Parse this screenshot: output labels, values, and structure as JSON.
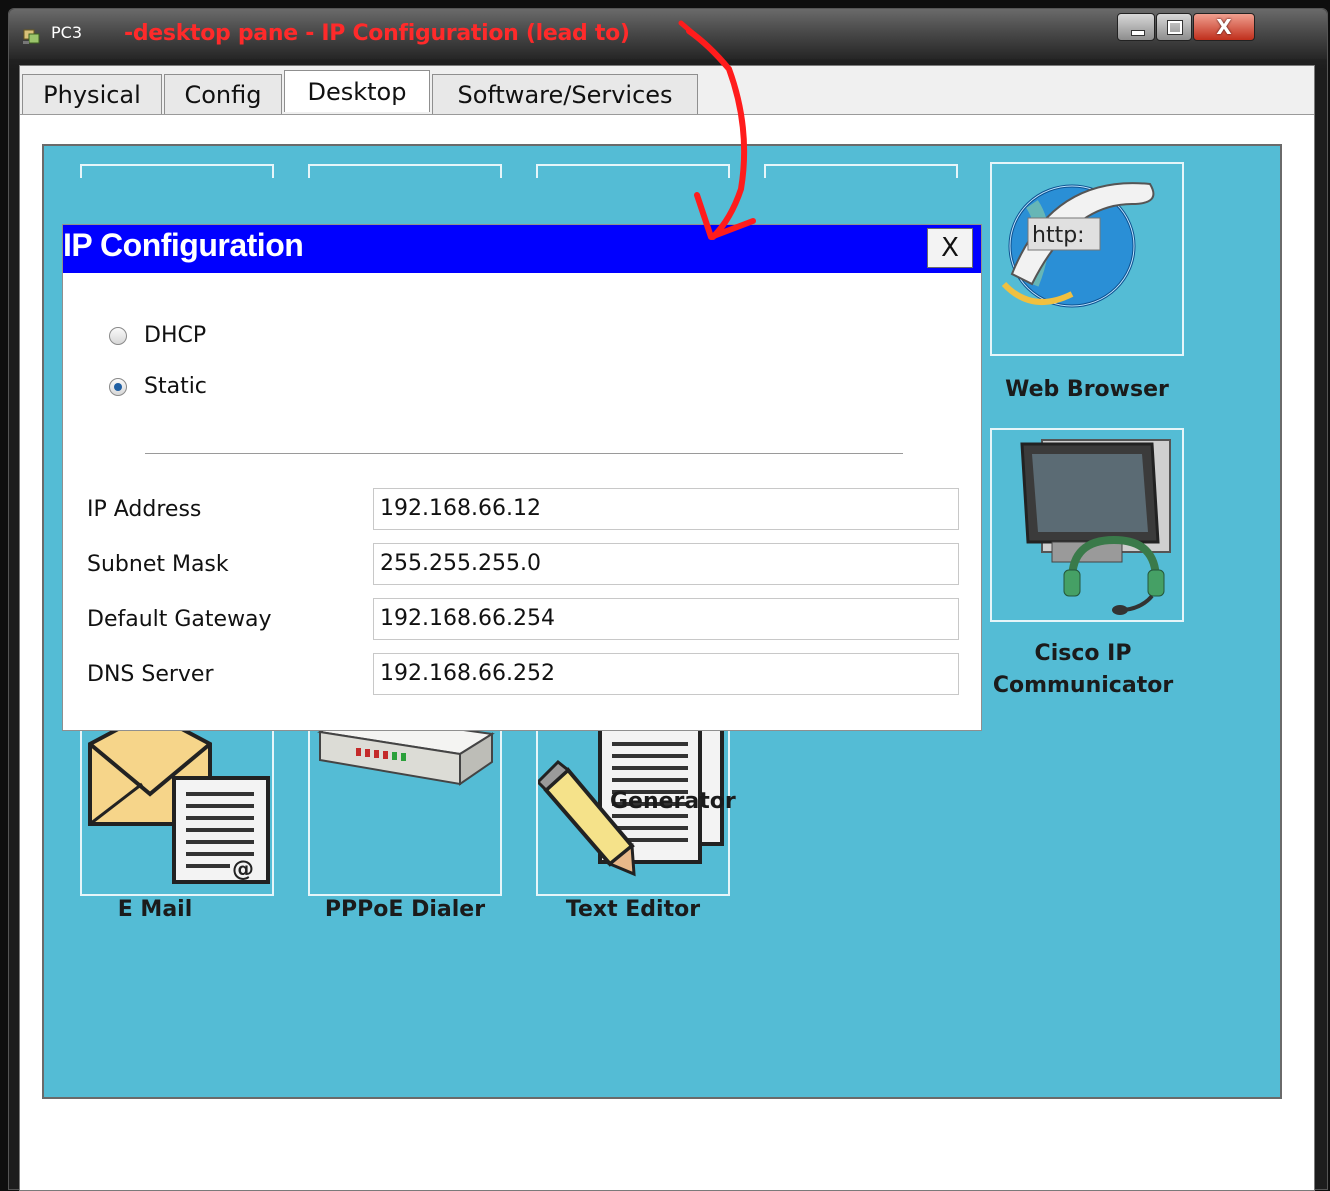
{
  "window": {
    "title": "PC3",
    "annotation": "-desktop pane - IP Configuration (lead to)",
    "close_glyph": "X"
  },
  "tabs": [
    {
      "label": "Physical",
      "active": false
    },
    {
      "label": "Config",
      "active": false
    },
    {
      "label": "Desktop",
      "active": true
    },
    {
      "label": "Software/Services",
      "active": false
    }
  ],
  "ip_config": {
    "title": "IP Configuration",
    "close_label": "X",
    "mode_options": [
      {
        "label": "DHCP",
        "selected": false
      },
      {
        "label": "Static",
        "selected": true
      }
    ],
    "fields": [
      {
        "label": "IP Address",
        "value": "192.168.66.12"
      },
      {
        "label": "Subnet Mask",
        "value": "255.255.255.0"
      },
      {
        "label": "Default Gateway",
        "value": "192.168.66.254"
      },
      {
        "label": "DNS Server",
        "value": "192.168.66.252"
      }
    ]
  },
  "desktop_apps": [
    {
      "label": "Web Browser",
      "icon": "globe-http-icon"
    },
    {
      "label": "Cisco IP Communicator",
      "icon": "monitor-headset-icon"
    },
    {
      "label": "E Mail",
      "icon": "envelope-letter-icon"
    },
    {
      "label": "PPPoE Dialer",
      "icon": "modem-icon"
    },
    {
      "label": "Text Editor",
      "icon": "pencil-document-icon"
    }
  ],
  "hidden_label_fragment": "Generator",
  "colors": {
    "desktop_bg": "#54bcd5",
    "dialog_header": "#0000ff",
    "annotation": "#ff2a2a"
  }
}
